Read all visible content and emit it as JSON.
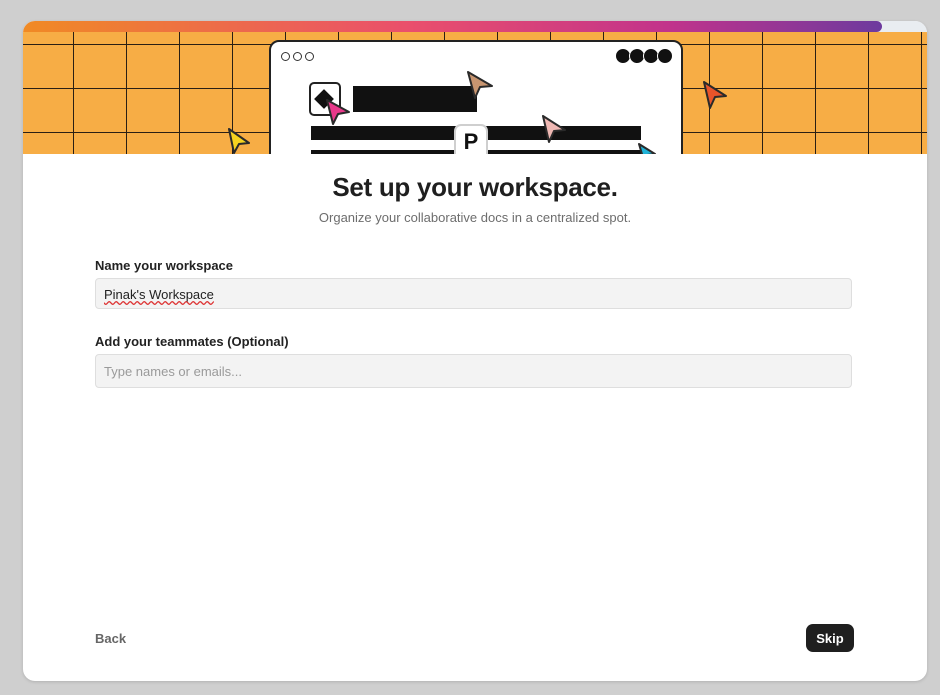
{
  "progress": {
    "percent": 95,
    "gradient": [
      "#f08a24",
      "#ea4f6c",
      "#c2338b",
      "#6d3a9e"
    ]
  },
  "banner": {
    "background": "#f7ad45",
    "badge_letter": "P"
  },
  "main": {
    "title": "Set up your workspace.",
    "subtitle": "Organize your collaborative docs in a centralized spot."
  },
  "form": {
    "workspace_label": "Name your workspace",
    "workspace_value": "Pinak's Workspace",
    "teammates_label": "Add your teammates (Optional)",
    "teammates_placeholder": "Type names or emails..."
  },
  "footer": {
    "back_label": "Back",
    "skip_label": "Skip"
  }
}
